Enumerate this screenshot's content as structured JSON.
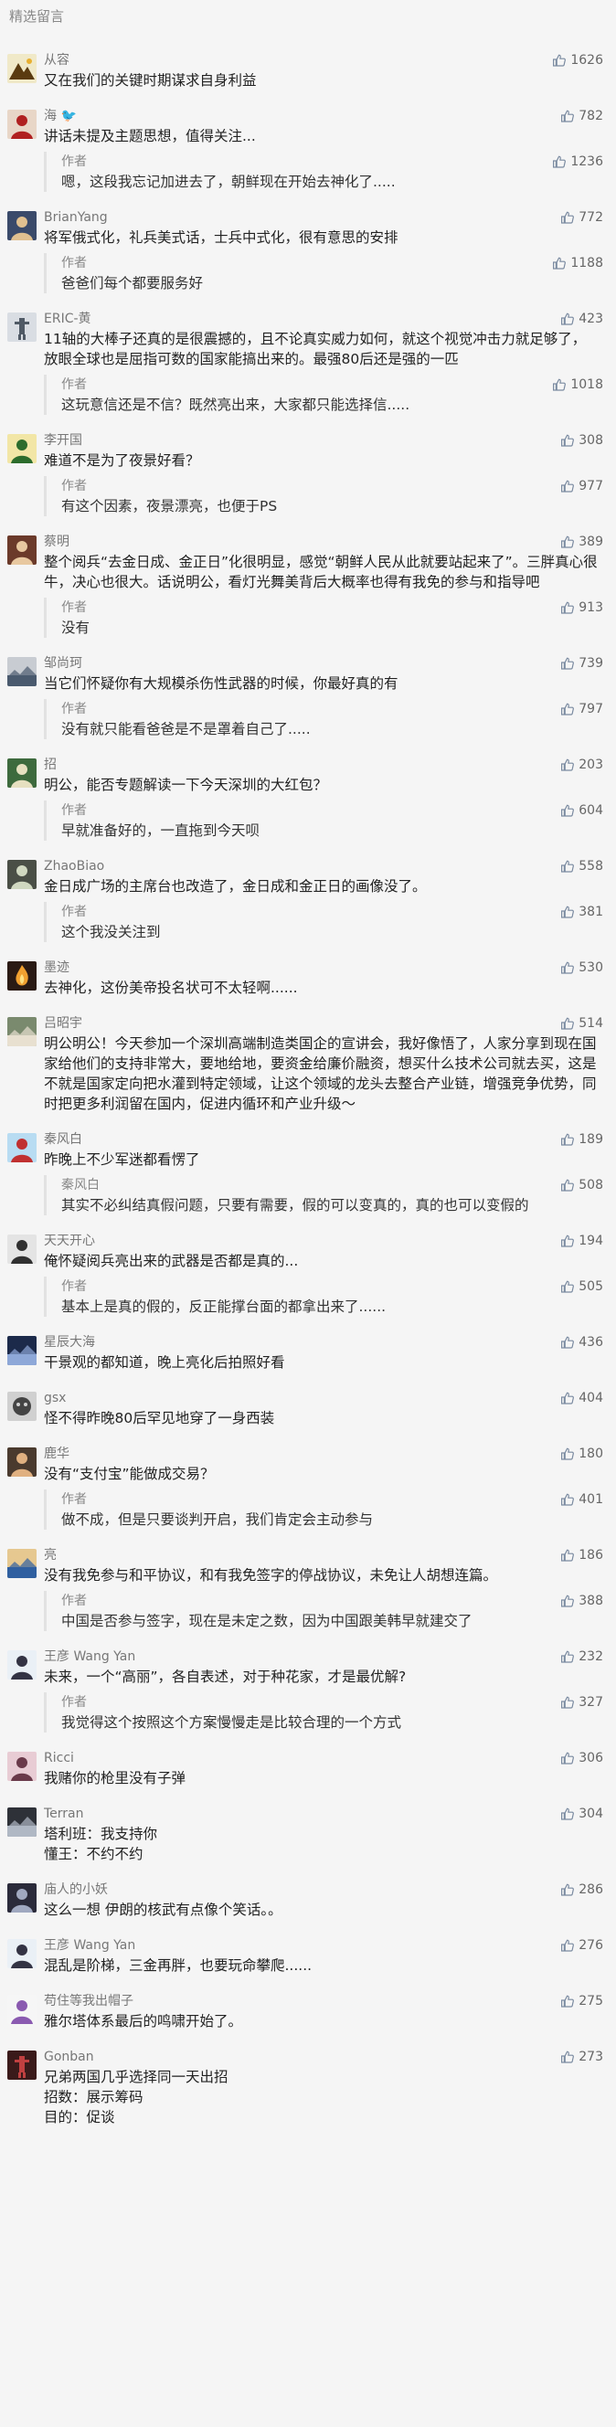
{
  "section_title": "精选留言",
  "comments": [
    {
      "nick": "从容",
      "likes": "1626",
      "text": "又在我们的关键时期谋求自身利益",
      "reply": null
    },
    {
      "nick": "海 🐦",
      "likes": "782",
      "text": "讲话未提及主题思想，值得关注...",
      "reply": {
        "author": "作者",
        "likes": "1236",
        "text": "嗯，这段我忘记加进去了，朝鲜现在开始去神化了....."
      }
    },
    {
      "nick": "BrianYang",
      "likes": "772",
      "text": "将军俄式化，礼兵美式话，士兵中式化，很有意思的安排",
      "reply": {
        "author": "作者",
        "likes": "1188",
        "text": "爸爸们每个都要服务好"
      }
    },
    {
      "nick": "ERIC-黄",
      "likes": "423",
      "text": "11轴的大棒子还真的是很震撼的，且不论真实威力如何，就这个视觉冲击力就足够了，放眼全球也是屈指可数的国家能搞出来的。最强80后还是强的一匹",
      "reply": {
        "author": "作者",
        "likes": "1018",
        "text": "这玩意信还是不信？既然亮出来，大家都只能选择信....."
      }
    },
    {
      "nick": "李开国",
      "likes": "308",
      "text": "难道不是为了夜景好看？",
      "reply": {
        "author": "作者",
        "likes": "977",
        "text": "有这个因素，夜景漂亮，也便于PS"
      }
    },
    {
      "nick": "蔡明",
      "likes": "389",
      "text": "整个阅兵“去金日成、金正日”化很明显，感觉“朝鲜人民从此就要站起来了”。三胖真心很牛，决心也很大。话说明公，看灯光舞美背后大概率也得有我免的参与和指导吧",
      "reply": {
        "author": "作者",
        "likes": "913",
        "text": "没有"
      }
    },
    {
      "nick": "邹尚珂",
      "likes": "739",
      "text": "当它们怀疑你有大规模杀伤性武器的时候，你最好真的有",
      "reply": {
        "author": "作者",
        "likes": "797",
        "text": "没有就只能看爸爸是不是罩着自己了....."
      }
    },
    {
      "nick": "招",
      "likes": "203",
      "text": "明公，能否专题解读一下今天深圳的大红包？",
      "reply": {
        "author": "作者",
        "likes": "604",
        "text": "早就准备好的，一直拖到今天呗"
      }
    },
    {
      "nick": "ZhaoBiao",
      "likes": "558",
      "text": "金日成广场的主席台也改造了，金日成和金正日的画像没了。",
      "reply": {
        "author": "作者",
        "likes": "381",
        "text": "这个我没关注到"
      }
    },
    {
      "nick": "墨迹",
      "likes": "530",
      "text": "去神化，这份美帝投名状可不太轻啊......",
      "reply": null
    },
    {
      "nick": "吕昭宇",
      "likes": "514",
      "text": "明公明公！今天参加一个深圳高端制造类国企的宣讲会，我好像悟了，人家分享到现在国家给他们的支持非常大，要地给地，要资金给廉价融资，想买什么技术公司就去买，这是不就是国家定向把水灌到特定领域，让这个领域的龙头去整合产业链，增强竞争优势，同时把更多利润留在国内，促进内循环和产业升级～",
      "reply": null
    },
    {
      "nick": "秦风白",
      "likes": "189",
      "text": "昨晚上不少军迷都看愣了",
      "reply": {
        "author": "秦风白",
        "likes": "508",
        "text": "其实不必纠结真假问题，只要有需要，假的可以变真的，真的也可以变假的"
      }
    },
    {
      "nick": "天天开心",
      "likes": "194",
      "text": "俺怀疑阅兵亮出来的武器是否都是真的...",
      "reply": {
        "author": "作者",
        "likes": "505",
        "text": "基本上是真的假的，反正能撑台面的都拿出来了......"
      }
    },
    {
      "nick": "星辰大海",
      "likes": "436",
      "text": "干景观的都知道，晚上亮化后拍照好看",
      "reply": null
    },
    {
      "nick": "gsx",
      "likes": "404",
      "text": "怪不得昨晚80后罕见地穿了一身西装",
      "reply": null
    },
    {
      "nick": "鹿华",
      "likes": "180",
      "text": "没有“支付宝”能做成交易？",
      "reply": {
        "author": "作者",
        "likes": "401",
        "text": "做不成，但是只要谈判开启，我们肯定会主动参与"
      }
    },
    {
      "nick": "亮",
      "likes": "186",
      "text": "没有我免参与和平协议，和有我免签字的停战协议，未免让人胡想连篇。",
      "reply": {
        "author": "作者",
        "likes": "388",
        "text": "中国是否参与签字，现在是未定之数，因为中国跟美韩早就建交了"
      }
    },
    {
      "nick": "王彦 Wang Yan",
      "likes": "232",
      "text": "未来，一个“高丽”，各自表述，对于种花家，才是最优解?",
      "reply": {
        "author": "作者",
        "likes": "327",
        "text": "我觉得这个按照这个方案慢慢走是比较合理的一个方式"
      }
    },
    {
      "nick": "Ricci",
      "likes": "306",
      "text": "我赌你的枪里没有子弹",
      "reply": null
    },
    {
      "nick": "Terran",
      "likes": "304",
      "text": "塔利班：我支持你\n懂王：不约不约",
      "reply": null
    },
    {
      "nick": "庙人的小妖",
      "likes": "286",
      "text": "这么一想 伊朗的核武有点像个笑话。。",
      "reply": null
    },
    {
      "nick": "王彦 Wang Yan",
      "likes": "276",
      "text": "混乱是阶梯，三金再胖，也要玩命攀爬......",
      "reply": null
    },
    {
      "nick": "苟住等我出帽子",
      "likes": "275",
      "text": "雅尔塔体系最后的鸣啸开始了。",
      "reply": null
    },
    {
      "nick": "Gonban",
      "likes": "273",
      "text": "兄弟两国几乎选择同一天出招\n招数：展示筹码\n目的：促谈",
      "reply": null
    }
  ]
}
